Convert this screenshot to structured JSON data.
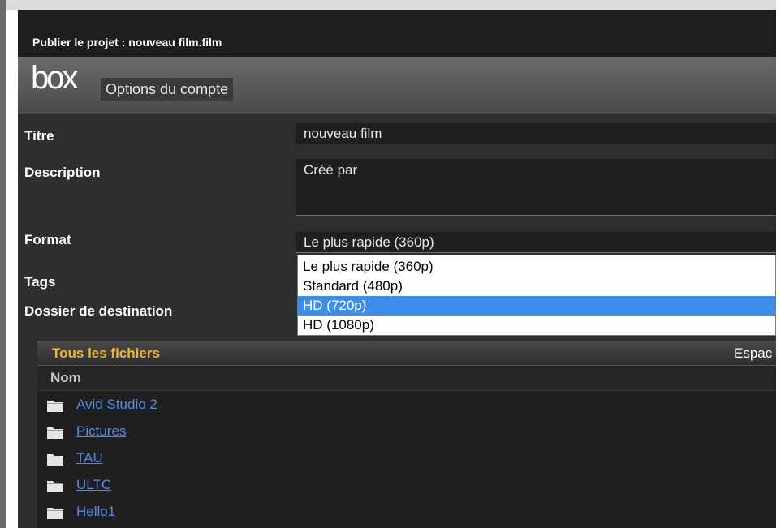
{
  "window": {
    "title": "Publier le projet : nouveau film.film"
  },
  "header": {
    "logo_text": "box",
    "account_button": "Options du compte"
  },
  "form": {
    "title_label": "Titre",
    "title_value": "nouveau film",
    "description_label": "Description",
    "description_value": "Créé par",
    "format_label": "Format",
    "format_value": "Le plus rapide (360p)",
    "tags_label": "Tags",
    "destination_label": "Dossier de destination"
  },
  "format_dropdown": {
    "options": [
      "Le plus rapide (360p)",
      "Standard (480p)",
      "HD (720p)",
      "HD (1080p)"
    ],
    "highlighted_index": 2
  },
  "files": {
    "title": "Tous les fichiers",
    "space_label": "Espac",
    "column_name": "Nom",
    "folders": [
      "Avid Studio 2",
      "Pictures",
      "TAU",
      "ULTC",
      "Hello1"
    ],
    "icon": "folder-icon"
  },
  "colors": {
    "accent_selection": "#3d8ee8",
    "files_title": "#f0b63a",
    "link": "#5a88dc"
  }
}
